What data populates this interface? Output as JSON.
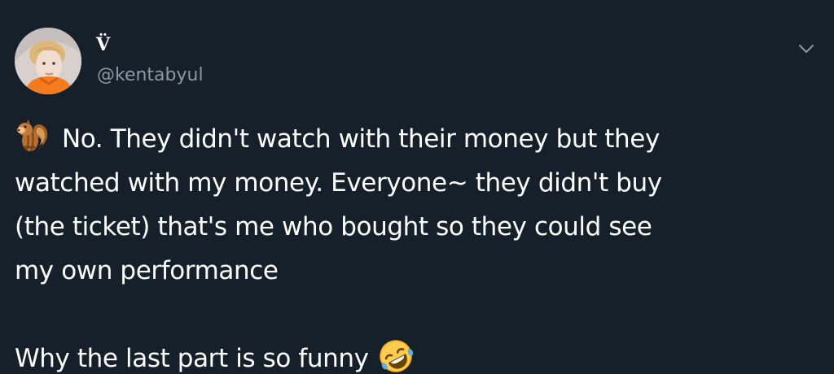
{
  "tweet": {
    "user": {
      "display_name": "V̈",
      "handle": "@kentabyul"
    },
    "text_lines": [
      "No. They didn't watch with their money but they",
      "watched with my money. Everyone~ they didn't buy",
      "(the ticket) that's me who bought so they could see",
      "my own performance"
    ],
    "final_line": "Why the last part is so funny",
    "icons": {
      "avatar": "profile-photo",
      "menu": "chevron-down-icon",
      "leading_emoji": "chipmunk-emoji",
      "trailing_emoji": "rolling-on-the-floor-laughing-emoji"
    },
    "colors": {
      "background": "#15202b",
      "primary_text": "#ffffff",
      "secondary_text": "#8899a6"
    }
  }
}
